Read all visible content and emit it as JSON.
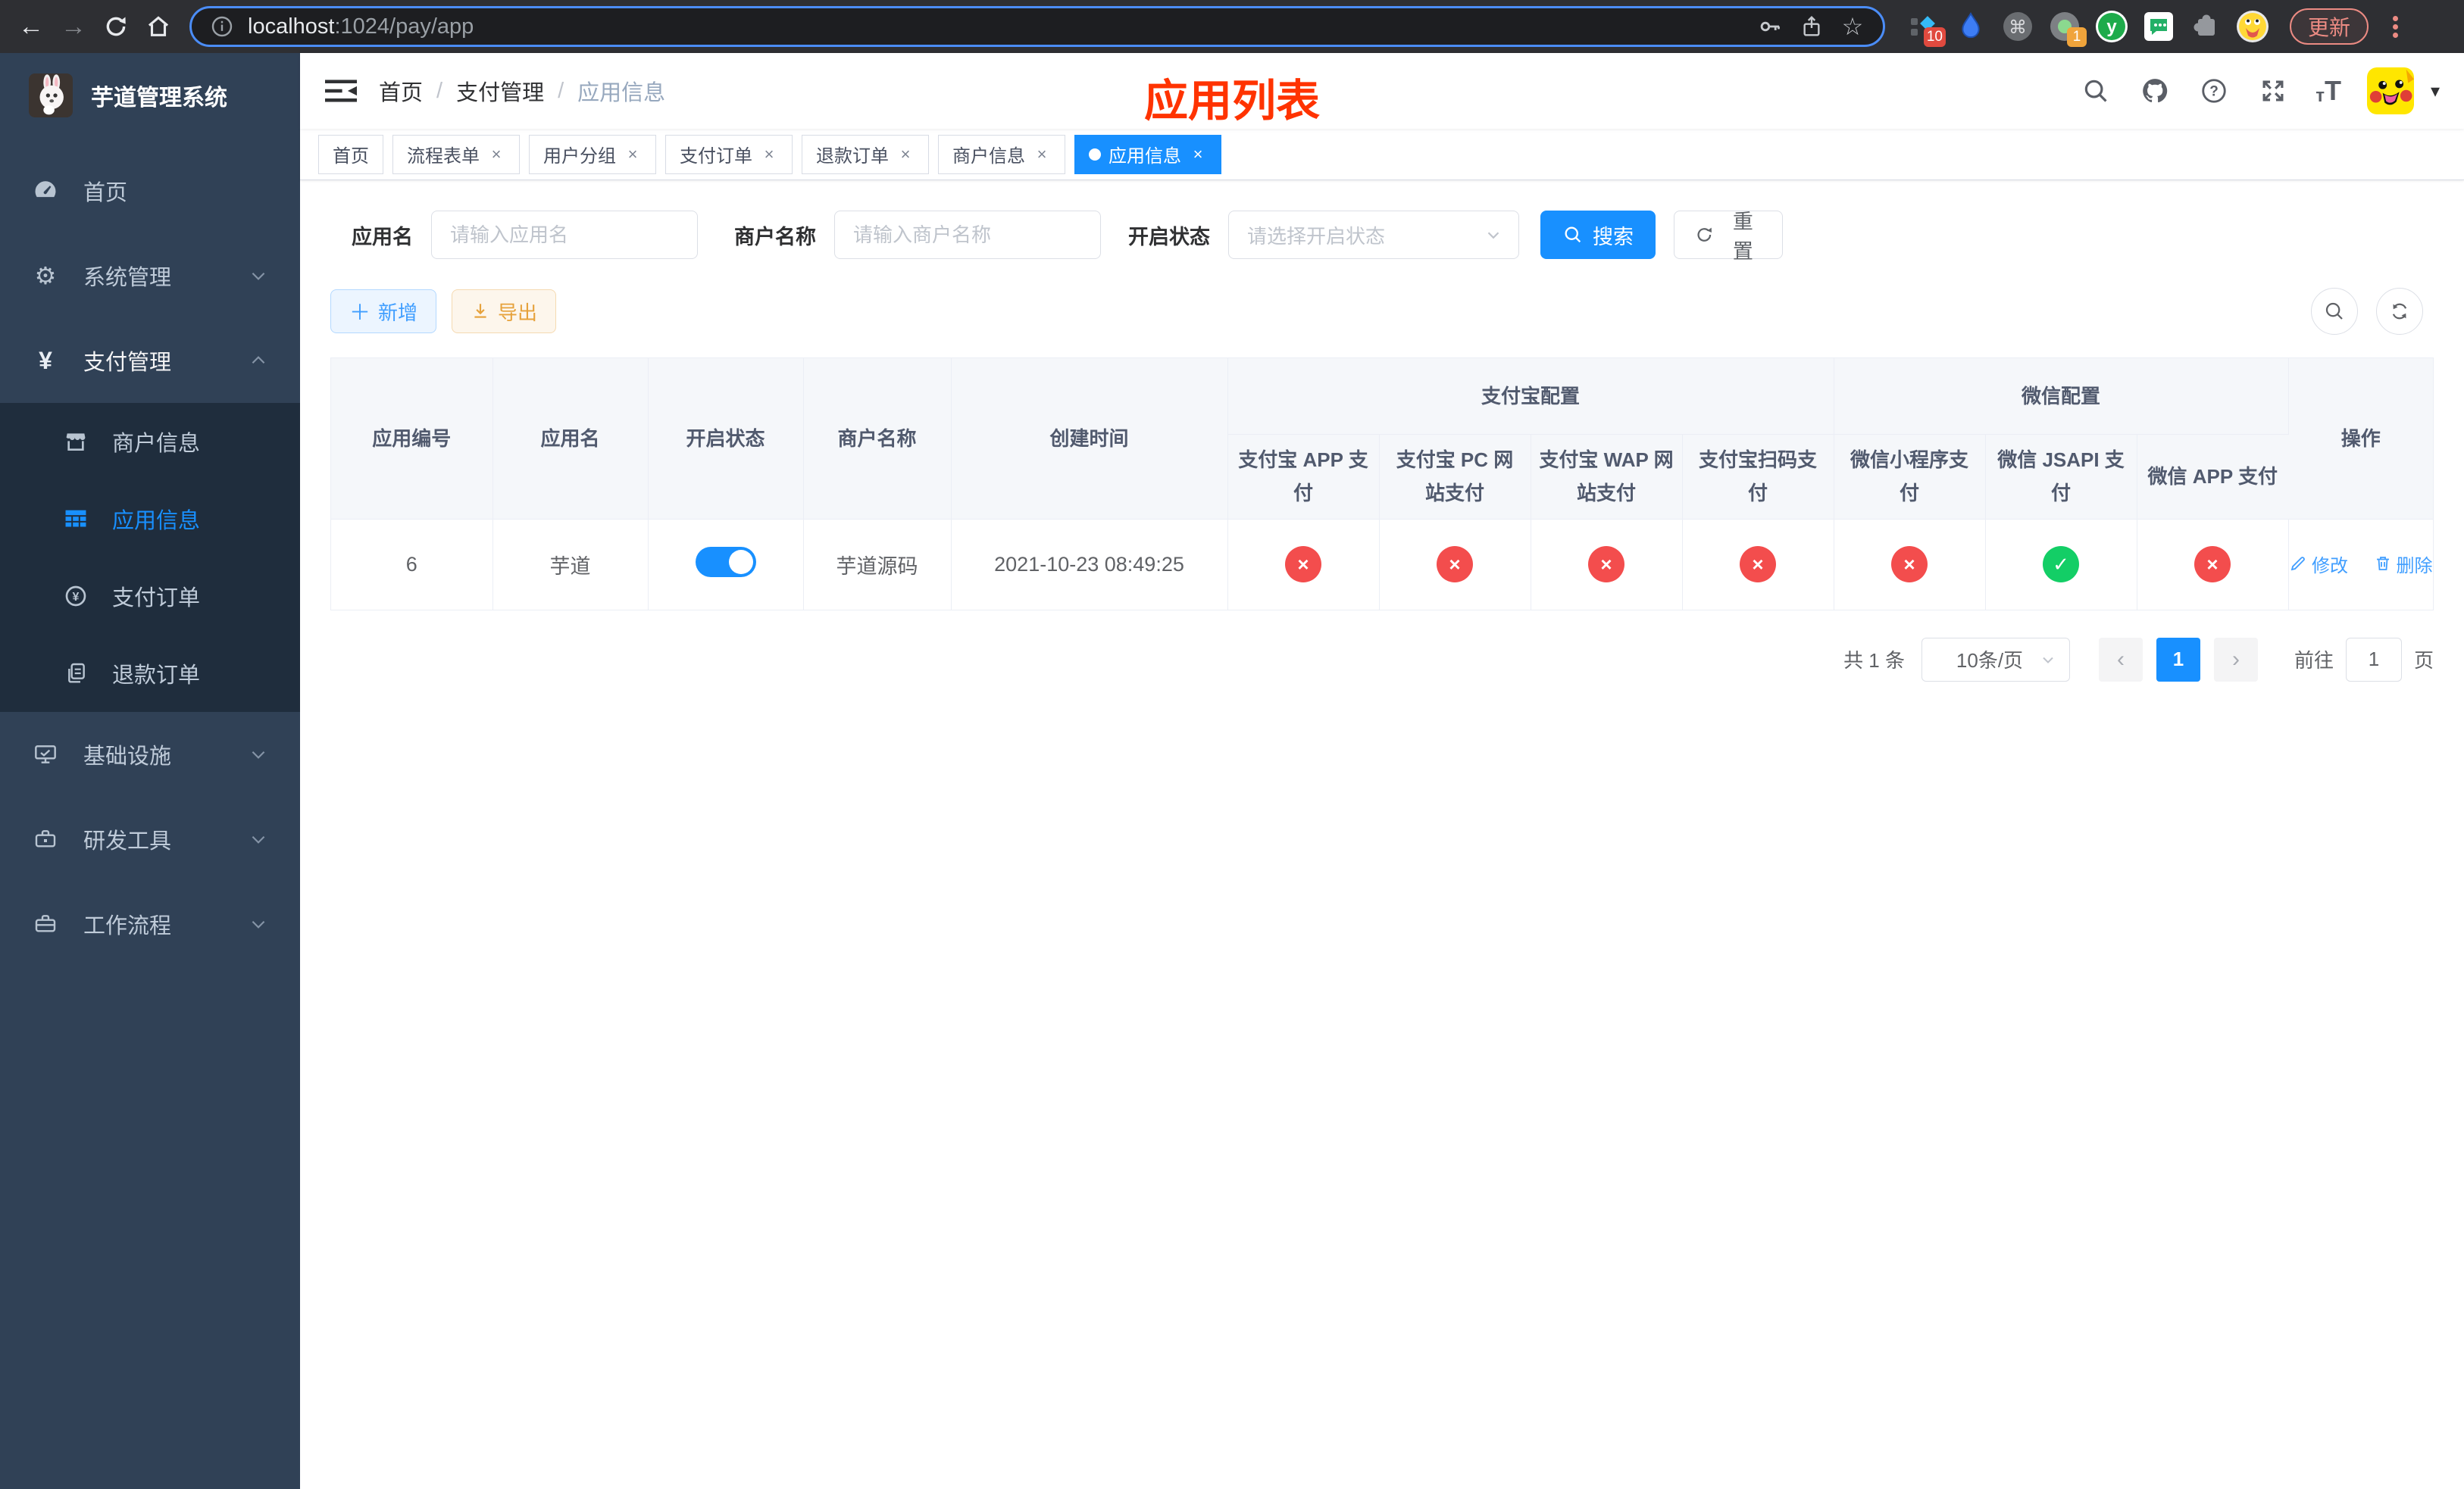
{
  "browser": {
    "url": {
      "host": "localhost",
      "path": ":1024/pay/app"
    },
    "update_label": "更新",
    "extension_badges": {
      "pinned_count": "10",
      "notification_count": "1"
    }
  },
  "sidebar": {
    "title": "芋道管理系统",
    "items": [
      {
        "label": "首页"
      },
      {
        "label": "系统管理"
      },
      {
        "label": "支付管理"
      },
      {
        "label": "商户信息"
      },
      {
        "label": "应用信息"
      },
      {
        "label": "支付订单"
      },
      {
        "label": "退款订单"
      },
      {
        "label": "基础设施"
      },
      {
        "label": "研发工具"
      },
      {
        "label": "工作流程"
      }
    ]
  },
  "navbar": {
    "breadcrumb": [
      "首页",
      "支付管理",
      "应用信息"
    ],
    "page_title": "应用列表"
  },
  "tabs": [
    {
      "label": "首页",
      "closable": false,
      "active": false
    },
    {
      "label": "流程表单",
      "closable": true,
      "active": false
    },
    {
      "label": "用户分组",
      "closable": true,
      "active": false
    },
    {
      "label": "支付订单",
      "closable": true,
      "active": false
    },
    {
      "label": "退款订单",
      "closable": true,
      "active": false
    },
    {
      "label": "商户信息",
      "closable": true,
      "active": false
    },
    {
      "label": "应用信息",
      "closable": true,
      "active": true
    }
  ],
  "filters": {
    "app_name": {
      "label": "应用名",
      "placeholder": "请输入应用名",
      "value": ""
    },
    "merchant_name": {
      "label": "商户名称",
      "placeholder": "请输入商户名称",
      "value": ""
    },
    "status": {
      "label": "开启状态",
      "placeholder": "请选择开启状态",
      "value": ""
    },
    "search_label": "搜索",
    "reset_label": "重置"
  },
  "toolbar": {
    "add_label": "新增",
    "export_label": "导出"
  },
  "table": {
    "columns": [
      "应用编号",
      "应用名",
      "开启状态",
      "商户名称",
      "创建时间"
    ],
    "groups": [
      {
        "label": "支付宝配置",
        "children": [
          "支付宝 APP 支付",
          "支付宝 PC 网站支付",
          "支付宝 WAP 网站支付",
          "支付宝扫码支付"
        ]
      },
      {
        "label": "微信配置",
        "children": [
          "微信小程序支付",
          "微信 JSAPI 支付",
          "微信 APP 支付"
        ]
      }
    ],
    "actions_label": "操作",
    "icons": {
      "enabled": "✓",
      "disabled": "×"
    },
    "rows": [
      {
        "id": "6",
        "name": "芋道",
        "enabled": true,
        "merchant": "芋道源码",
        "created": "2021-10-23 08:49:25",
        "channels": [
          "disabled",
          "disabled",
          "disabled",
          "disabled",
          "disabled",
          "enabled",
          "disabled"
        ],
        "actions": {
          "edit": "修改",
          "delete": "删除"
        }
      }
    ]
  },
  "pagination": {
    "total": "共 1 条",
    "page_size": "10条/页",
    "page": "1",
    "goto_label": "前往",
    "goto_value": "1",
    "unit_label": "页"
  },
  "colors": {
    "accent": "#1890ff",
    "link": "#409eff",
    "danger": "#f34d4d",
    "success": "#13ce66",
    "warning": "#e6a23c",
    "sidebar_bg": "#304156",
    "submenu_bg": "#1f2d3d",
    "sidebar_text": "#bfcbd9",
    "title_red": "#ff3300"
  }
}
